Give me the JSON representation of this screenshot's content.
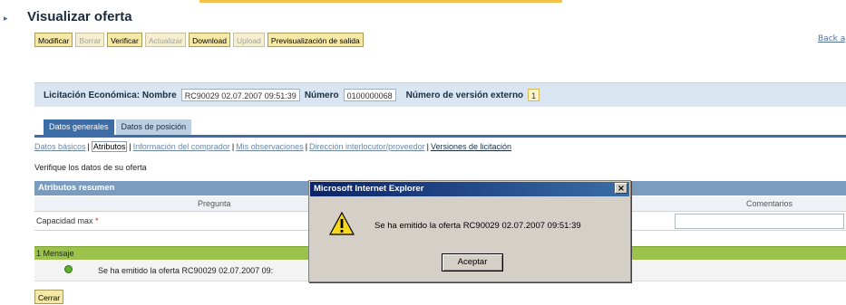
{
  "page": {
    "title": "Visualizar oferta",
    "back_link": "Back a"
  },
  "toolbar": {
    "buttons": [
      {
        "label": "Modificar",
        "enabled": true
      },
      {
        "label": "Borrar",
        "enabled": false
      },
      {
        "label": "Verificar",
        "enabled": true
      },
      {
        "label": "Actualizar",
        "enabled": false
      },
      {
        "label": "Download",
        "enabled": true
      },
      {
        "label": "Upload",
        "enabled": false
      },
      {
        "label": "Previsualización de salida",
        "enabled": true
      }
    ]
  },
  "header": {
    "title_label": "Licitación Económica: Nombre",
    "name_value": "RC90029 02.07.2007 09:51:39",
    "number_label": "Número",
    "number_value": "0100000068",
    "ext_version_label": "Número de versión externo",
    "ext_version_value": "1"
  },
  "tabs": [
    {
      "label": "Datos generales",
      "active": true
    },
    {
      "label": "Datos de posición",
      "active": false
    }
  ],
  "sublinks": {
    "basic": "Datos básicos",
    "attributes": "Atributos",
    "buyer_info": "Información del comprador",
    "observations": "Mis observaciones",
    "contact_address": "Dirección interlocutor/proveedor",
    "versions": "Versiones de licitación"
  },
  "instruction": "Verifique los datos de su oferta",
  "attributes": {
    "heading": "Atributos resumen",
    "columns": {
      "question": "Pregunta",
      "comments": "Comentarios"
    },
    "rows": [
      {
        "question": "Capacidad max",
        "required_mark": "*"
      }
    ]
  },
  "messages": {
    "bar_label": "1 Mensaje",
    "items": [
      {
        "text": "Se ha emitido la oferta RC90029 02.07.2007 09:"
      }
    ],
    "close_label": "Cerrar"
  },
  "dialog": {
    "title": "Microsoft Internet Explorer",
    "close_glyph": "×",
    "message": "Se ha emitido la oferta RC90029 02.07.2007 09:51:39",
    "ok_label": "Aceptar"
  },
  "colors": {
    "toolbar_button": "#f6e9a6",
    "header_band": "#d9e6f1",
    "tab_active": "#3c6da6",
    "message_bar": "#9bc24a",
    "dialog_title": "#0a246a"
  }
}
